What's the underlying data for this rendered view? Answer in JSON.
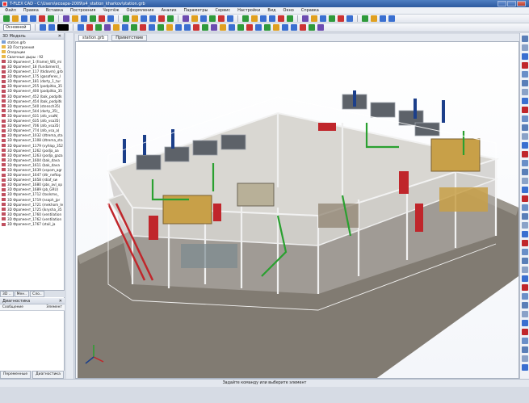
{
  "window": {
    "title": "T-FLEX CAD - C:\\Users\\ecoapa-2009\\s4_station_kharkov\\station.grb"
  },
  "menu": [
    "Файл",
    "Правка",
    "Вставка",
    "Построения",
    "Чертёж",
    "Оформление",
    "Анализ",
    "Параметры",
    "Сервис",
    "Настройки",
    "Вид",
    "Окно",
    "Справка"
  ],
  "toolbar": {
    "view_combo": "Основной"
  },
  "model_panel": {
    "title": "3D Модель",
    "root": "station.grb",
    "items": [
      "3D Построения",
      "Операции",
      "Сваечные дыры : 92",
      "3D Фрагмент_1 (frame)_WS_mi",
      "3D Фрагмент_18 (fundament)_",
      "3D Фрагмент_117 (tkdovm)_grb",
      "3D Фрагмент_175 (gasoferes_l",
      "3D Фрагмент_181 (dorty_1_tur",
      "3D Фрагмент_255 (podpitka_35",
      "3D Фрагмент_400 (podpitka_35",
      "3D Фрагмент_452 (bak_podpitk",
      "3D Фрагмент_454 (bak_podpitk",
      "3D Фрагмент_540 (stensch35(",
      "3D Фрагмент_544 (dorty_35)_",
      "3D Фрагмент_631 (afo_vsaN(",
      "3D Фрагмент_635 (afo_vsa35(",
      "3D Фрагмент_706 (afo_vsa35(",
      "3D Фрагмент_774 (afo_vsa_a(",
      "3D Фрагмент_1032 (dtrema_sta",
      "3D Фрагмент_1108 (dtrema_sta",
      "3D Фрагмент_1179 (vyhlop_352",
      "3D Фрагмент_1262 (podja_aa",
      "3D Фрагмент_1263 (podja_gaza",
      "3D Фрагмент_1604 (bak_dava",
      "3D Фрагмент_1611 (bak_dava",
      "3D Фрагмент_1639 (vspom_agr",
      "3D Фрагмент_1647 (dtr_neftop",
      "3D Фрагмент_1658 (rdiaf_sw",
      "3D Фрагмент_1680 (pbs_avl_op",
      "3D Фрагмент_1689 (pb_GRU)",
      "3D Фрагмент_1712 (toolsme_",
      "3D Фрагмент_1719 (nsoph_jpr",
      "3D Фрагмент_1721 (mekhom_le",
      "3D Фрагмент_1725 (ikrysha_35",
      "3D Фрагмент_1760 (ventilation",
      "3D Фрагмент_1762 (ventilation",
      "3D Фрагмент_1767 (stoil_ja"
    ],
    "tabs": [
      "3D ..",
      "Мен..",
      "Сло.."
    ]
  },
  "diagnostics": {
    "title": "Диагностика",
    "col1": "Сообщение",
    "col2": "Элемент"
  },
  "bottom_tabs": [
    "Переменные",
    "Диагностика"
  ],
  "doc_tabs": [
    "station.grb",
    "Приветствие"
  ],
  "status": "Задайте команду или выберите элемент",
  "colors": {
    "accent": "#3366b3",
    "floor": "#857f76",
    "frame": "#d8d8d8",
    "equipment": "#c8a048",
    "wall_red": "#c0262b"
  }
}
